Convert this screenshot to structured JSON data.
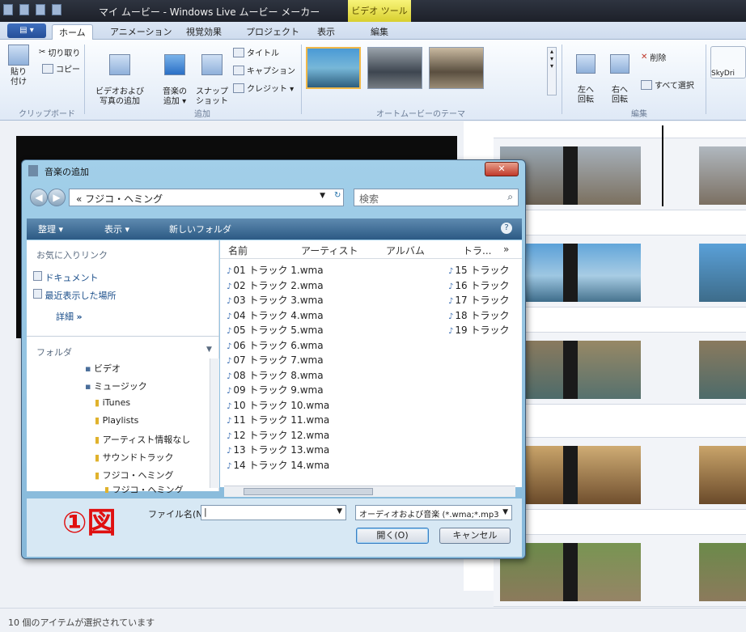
{
  "titlebar": {
    "title": "マイ ムービー - Windows Live ムービー メーカー",
    "context_tab": "ビデオ ツール"
  },
  "tabs": [
    "ホーム",
    "アニメーション",
    "視覚効果",
    "プロジェクト",
    "表示",
    "編集"
  ],
  "ribbon": {
    "paste": "貼り\n付け",
    "cut": "切り取り",
    "copy": "コピー",
    "clipboard_group": "クリップボード",
    "add_video": "ビデオおよび\n写真の追加",
    "add_music": "音楽の\n追加 ▾",
    "snapshot": "スナップ\nショット",
    "title_btn": "タイトル",
    "caption_btn": "キャプション",
    "credit_btn": "クレジット ▾",
    "add_group": "追加",
    "theme_group": "オートムービーのテーマ",
    "rotate_left": "左へ\n回転",
    "rotate_right": "右へ\n回転",
    "delete": "削除",
    "select_all": "すべて選択",
    "edit_group": "編集",
    "skydrive": "SkyDri"
  },
  "dialog": {
    "title": "音楽の追加",
    "address": "« フジコ・ヘミング",
    "search_placeholder": "検索",
    "toolbar": {
      "organize": "整理 ▾",
      "view": "表示 ▾",
      "new_folder": "新しいフォルダ"
    },
    "fav_header": "お気に入りリンク",
    "fav_links": [
      "ドキュメント",
      "最近表示した場所"
    ],
    "details": "詳細",
    "folder_header": "フォルダ",
    "tree": [
      "ビデオ",
      "ミュージック",
      "iTunes",
      "Playlists",
      "アーティスト情報なし",
      "サウンドトラック",
      "フジコ・ヘミング",
      "フジコ・ヘミング"
    ],
    "columns": {
      "name": "名前",
      "artist": "アーティスト",
      "album": "アルバム",
      "track": "トラ...",
      "more": "»"
    },
    "files_left": [
      "01 トラック 1.wma",
      "02 トラック 2.wma",
      "03 トラック 3.wma",
      "04 トラック 4.wma",
      "05 トラック 5.wma",
      "06 トラック 6.wma",
      "07 トラック 7.wma",
      "08 トラック 8.wma",
      "09 トラック 9.wma",
      "10 トラック 10.wma",
      "11 トラック 11.wma",
      "12 トラック 12.wma",
      "13 トラック 13.wma",
      "14 トラック 14.wma"
    ],
    "files_right": [
      "15 トラック",
      "16 トラック",
      "17 トラック",
      "18 トラック",
      "19 トラック"
    ],
    "filename_label": "ファイル名(N):",
    "filename_value": "",
    "filetype": "オーディオおよび音楽 (*.wma;*.mp3",
    "open_btn": "開く(O)",
    "cancel_btn": "キャンセル"
  },
  "annotation": "①図",
  "status": "10 個のアイテムが選択されています"
}
